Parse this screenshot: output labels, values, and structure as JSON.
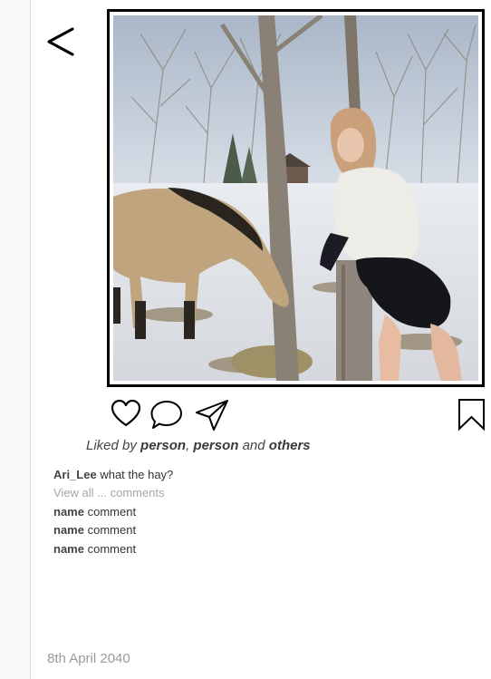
{
  "nav": {
    "back_glyph": "<",
    "back_icon": "chevron-left-icon"
  },
  "post": {
    "image_alt": "",
    "liked_by": {
      "prefix": "Liked by",
      "first": "person",
      "separator": ",",
      "second": "person",
      "conjunction": "and",
      "last": "others"
    },
    "caption": {
      "username": "Ari_Lee",
      "text": "what the hay?"
    },
    "view_all": "View all ... comments",
    "comments": [
      {
        "username": "name",
        "text": "comment"
      },
      {
        "username": "name",
        "text": "comment"
      },
      {
        "username": "name",
        "text": "comment"
      }
    ],
    "date": "8th April 2040"
  },
  "actions": {
    "like_icon": "heart-icon",
    "comment_icon": "speech-bubble-icon",
    "share_icon": "paper-plane-icon",
    "save_icon": "bookmark-icon"
  },
  "colors": {
    "frame": "#000000",
    "username": "#444444",
    "muted": "#a6a6a6",
    "date": "#9a9a9a",
    "sidebar": "#f7f8fa"
  }
}
